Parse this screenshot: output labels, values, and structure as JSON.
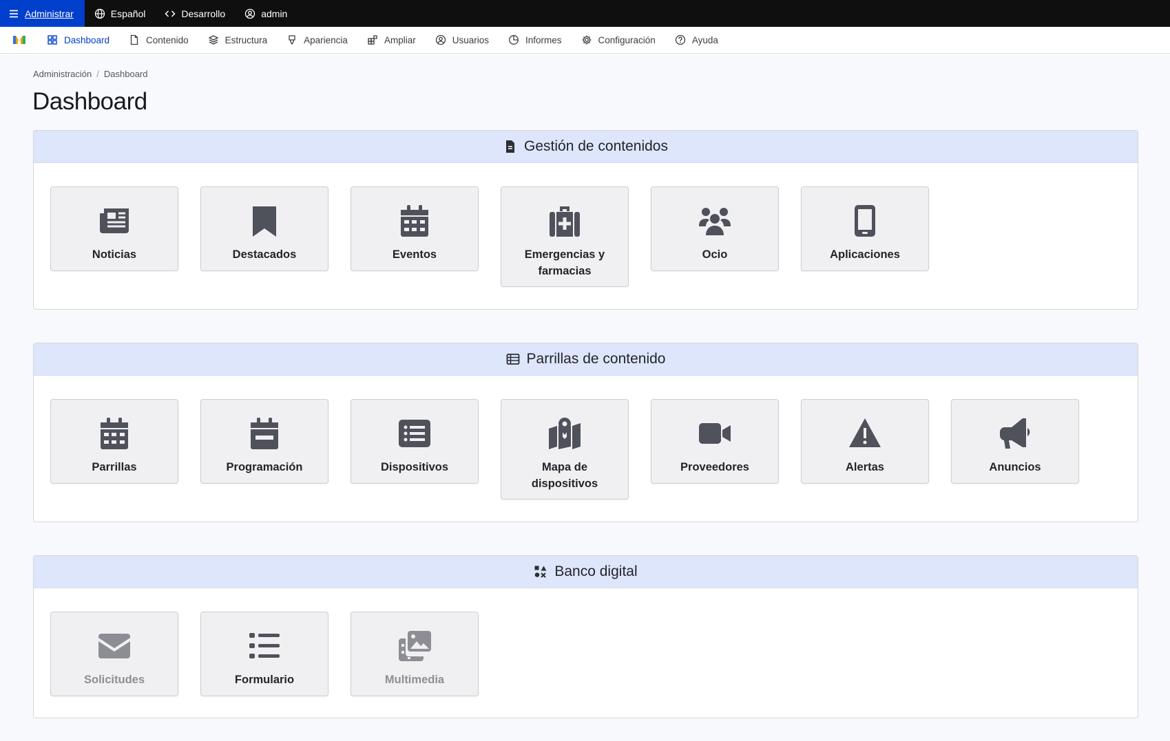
{
  "toolbar": {
    "admin": "Administrar",
    "language": "Español",
    "dev": "Desarrollo",
    "user": "admin"
  },
  "menu": [
    {
      "label": "Dashboard",
      "icon": "dashboard-icon",
      "active": true
    },
    {
      "label": "Contenido",
      "icon": "file-icon"
    },
    {
      "label": "Estructura",
      "icon": "layers-icon"
    },
    {
      "label": "Apariencia",
      "icon": "brush-icon"
    },
    {
      "label": "Ampliar",
      "icon": "puzzle-icon"
    },
    {
      "label": "Usuarios",
      "icon": "user-icon"
    },
    {
      "label": "Informes",
      "icon": "chart-icon"
    },
    {
      "label": "Configuración",
      "icon": "gear-icon"
    },
    {
      "label": "Ayuda",
      "icon": "help-icon"
    }
  ],
  "breadcrumb": [
    "Administración",
    "Dashboard"
  ],
  "page_title": "Dashboard",
  "sections": [
    {
      "title": "Gestión de contenidos",
      "icon": "document-icon",
      "tiles": [
        {
          "label": "Noticias",
          "icon": "newspaper-icon"
        },
        {
          "label": "Destacados",
          "icon": "bookmark-icon"
        },
        {
          "label": "Eventos",
          "icon": "calendar-icon"
        },
        {
          "label": "Emergencias y farmacias",
          "icon": "medkit-icon"
        },
        {
          "label": "Ocio",
          "icon": "people-icon"
        },
        {
          "label": "Aplicaciones",
          "icon": "mobile-icon"
        }
      ]
    },
    {
      "title": "Parrillas de contenido",
      "icon": "table-icon",
      "tiles": [
        {
          "label": "Parrillas",
          "icon": "calendar-days-icon"
        },
        {
          "label": "Programación",
          "icon": "calendar-minus-icon"
        },
        {
          "label": "Dispositivos",
          "icon": "list-box-icon"
        },
        {
          "label": "Mapa de dispositivos",
          "icon": "map-location-icon"
        },
        {
          "label": "Proveedores",
          "icon": "video-icon"
        },
        {
          "label": "Alertas",
          "icon": "warning-icon"
        },
        {
          "label": "Anuncios",
          "icon": "megaphone-icon"
        }
      ]
    },
    {
      "title": "Banco digital",
      "icon": "shapes-icon",
      "tiles": [
        {
          "label": "Solicitudes",
          "icon": "envelope-icon",
          "disabled": true
        },
        {
          "label": "Formulario",
          "icon": "list-icon"
        },
        {
          "label": "Multimedia",
          "icon": "images-icon",
          "disabled": true
        }
      ]
    }
  ]
}
